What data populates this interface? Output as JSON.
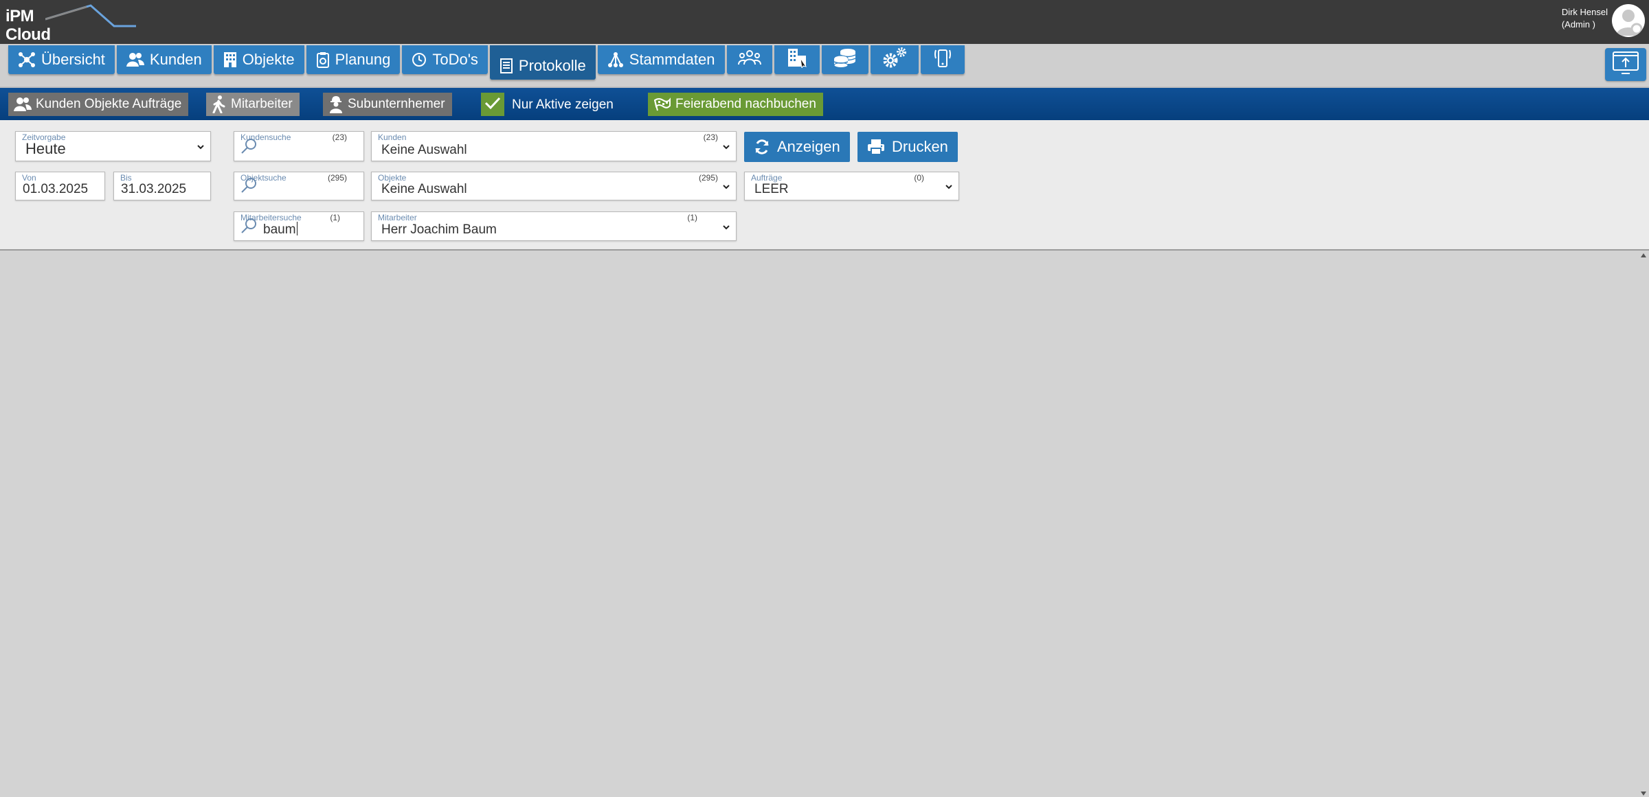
{
  "header": {
    "logo_line1": "iPM",
    "logo_line2": "Cloud",
    "user_name": "Dirk Hensel",
    "user_role": "(Admin )"
  },
  "nav": {
    "tabs": [
      {
        "label": "Übersicht",
        "icon": "network-icon"
      },
      {
        "label": "Kunden",
        "icon": "users-icon"
      },
      {
        "label": "Objekte",
        "icon": "building-icon"
      },
      {
        "label": "Planung",
        "icon": "clipboard-icon"
      },
      {
        "label": "ToDo's",
        "icon": "clock-icon"
      },
      {
        "label": "Protokolle",
        "icon": "document-icon",
        "active": true
      },
      {
        "label": "Stammdaten",
        "icon": "hierarchy-icon"
      }
    ],
    "icon_tabs": [
      "group-icon",
      "buildings-icon",
      "coins-icon",
      "gears-icon",
      "mobile-phone-icon"
    ],
    "right_icon": "screen-upload-icon"
  },
  "subbar": {
    "kunden_objekte_auftraege": "Kunden Objekte Aufträge",
    "mitarbeiter": "Mitarbeiter",
    "subunternehmer": "Subunternhemer",
    "nur_aktive": "Nur Aktive zeigen",
    "feierabend": "Feierabend nachbuchen"
  },
  "filters": {
    "zeitvorgabe": {
      "label": "Zeitvorgabe",
      "value": "Heute"
    },
    "von": {
      "label": "Von",
      "value": "01.03.2025"
    },
    "bis": {
      "label": "Bis",
      "value": "31.03.2025"
    },
    "kundensuche": {
      "label": "Kundensuche",
      "count": "(23)",
      "value": ""
    },
    "kunden": {
      "label": "Kunden",
      "count": "(23)",
      "value": "Keine Auswahl"
    },
    "objektsuche": {
      "label": "Objektsuche",
      "count": "(295)",
      "value": ""
    },
    "objekte": {
      "label": "Objekte",
      "count": "(295)",
      "value": "Keine Auswahl"
    },
    "mitarbeitersuche": {
      "label": "Mitarbeitersuche",
      "count": "(1)",
      "value": "baum"
    },
    "mitarbeiter": {
      "label": "Mitarbeiter",
      "count": "(1)",
      "value": "Herr Joachim Baum"
    },
    "auftraege": {
      "label": "Aufträge",
      "count": "(0)",
      "value": "LEER"
    }
  },
  "actions": {
    "anzeigen": "Anzeigen",
    "drucken": "Drucken"
  },
  "colors": {
    "topbar": "#3a3a3a",
    "tab_blue": "#2f7fc0",
    "subbar_blue": "#0a4a8c",
    "green": "#6a9a35",
    "panel": "#ebebeb"
  }
}
